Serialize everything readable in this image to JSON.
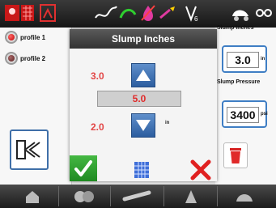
{
  "colors": {
    "accent": "#3f7ec4",
    "limit_red": "#e24545",
    "ok_green": "#2fa72f",
    "cancel_red": "#e02020"
  },
  "topbar": {
    "icons": [
      "stop-icon",
      "grid-red-icon",
      "slump-gauge-icon",
      "trend-icon",
      "hose-icon",
      "water-off-icon",
      "additive-icon",
      "valve-icon",
      "truck-icon",
      "link-icon"
    ]
  },
  "profiles": [
    {
      "label": "profile 1"
    },
    {
      "label": "profile 2"
    }
  ],
  "dialog": {
    "title": "Slump Inches",
    "upper_limit": "3.0",
    "value": "5.0",
    "lower_limit": "2.0",
    "unit": "in"
  },
  "right_panel": {
    "slump_label": "Slump Inches",
    "slump_value": "3.0",
    "slump_unit": "in",
    "pressure_label": "Slump Pressure",
    "pressure_value": "3400",
    "pressure_unit": "psi"
  },
  "bottombar": {
    "tabs": [
      "home-icon",
      "drum-icon",
      "chute-icon",
      "cone-icon",
      "settings-icon"
    ]
  }
}
